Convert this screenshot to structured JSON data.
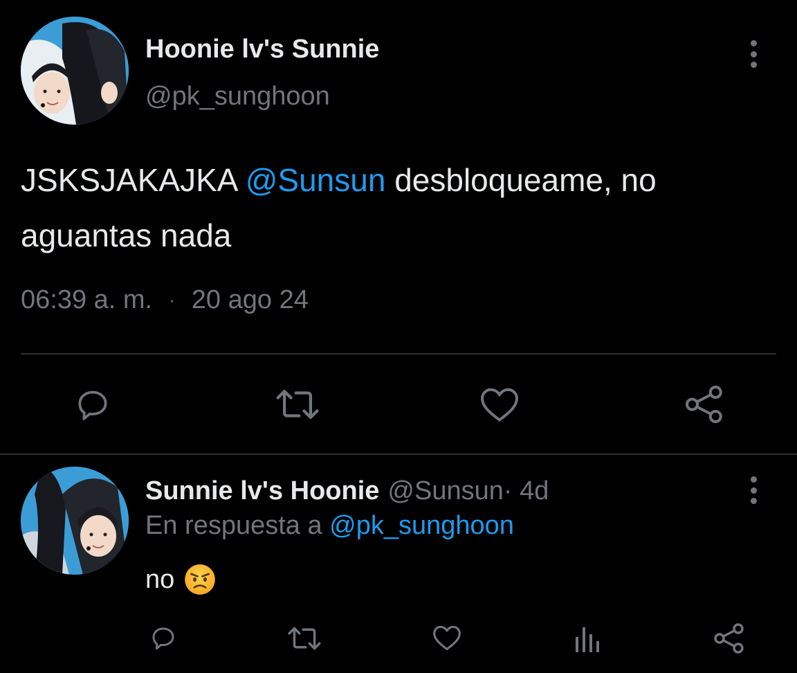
{
  "main_tweet": {
    "display_name": "Hoonie lv's Sunnie",
    "handle": "@pk_sunghoon",
    "text_before": "JSKSJAKAJKA ",
    "mention": "@Sunsun",
    "text_after": " desbloqueame, no aguantas nada",
    "time": "06:39 a. m.",
    "separator": "·",
    "date": "20 ago 24",
    "actions": [
      "reply-icon",
      "retweet-icon",
      "like-icon",
      "share-icon"
    ]
  },
  "reply": {
    "display_name": "Sunnie lv's Hoonie",
    "handle": "@Sunsun",
    "time": " · 4d",
    "reply_prefix": "En respuesta a ",
    "reply_to": "@pk_sunghoon",
    "text": "no",
    "emoji": "angry-face-emoji",
    "actions": [
      "reply-icon",
      "retweet-icon",
      "like-icon",
      "views-icon",
      "share-icon"
    ]
  },
  "colors": {
    "background": "#000000",
    "text_primary": "#e7e9ea",
    "text_secondary": "#71767b",
    "accent": "#1d9bf0",
    "divider": "#2f3336"
  }
}
